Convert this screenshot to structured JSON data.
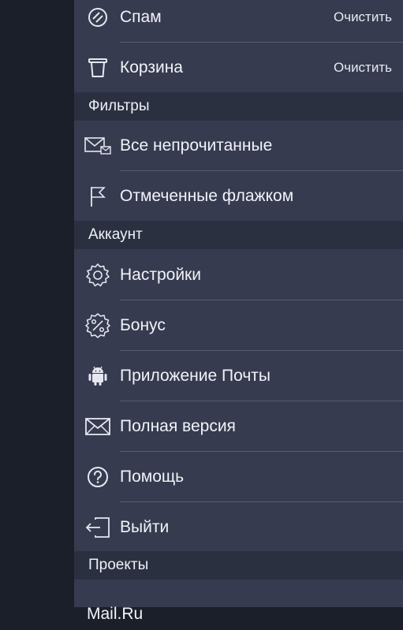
{
  "menu": {
    "spam": {
      "label": "Спам",
      "action": "Очистить",
      "icon": "spam-icon"
    },
    "trash": {
      "label": "Корзина",
      "action": "Очистить",
      "icon": "trash-icon"
    },
    "filters_title": "Фильтры",
    "unread": {
      "label": "Все непрочитанные",
      "icon": "unread-mail-icon"
    },
    "flagged": {
      "label": "Отмеченные флажком",
      "icon": "flag-icon"
    },
    "account_title": "Аккаунт",
    "settings": {
      "label": "Настройки",
      "icon": "gear-icon"
    },
    "bonus": {
      "label": "Бонус",
      "icon": "percent-badge-icon"
    },
    "app": {
      "label": "Приложение Почты",
      "icon": "android-icon"
    },
    "full": {
      "label": "Полная версия",
      "icon": "envelope-icon"
    },
    "help": {
      "label": "Помощь",
      "icon": "help-icon"
    },
    "logout": {
      "label": "Выйти",
      "icon": "logout-icon"
    },
    "projects_title": "Проекты",
    "mailru": {
      "label": "Mail.Ru"
    }
  },
  "colors": {
    "drawer_bg": "#363b50",
    "section_bg": "#2b3041",
    "backdrop": "#1b1f2a"
  }
}
